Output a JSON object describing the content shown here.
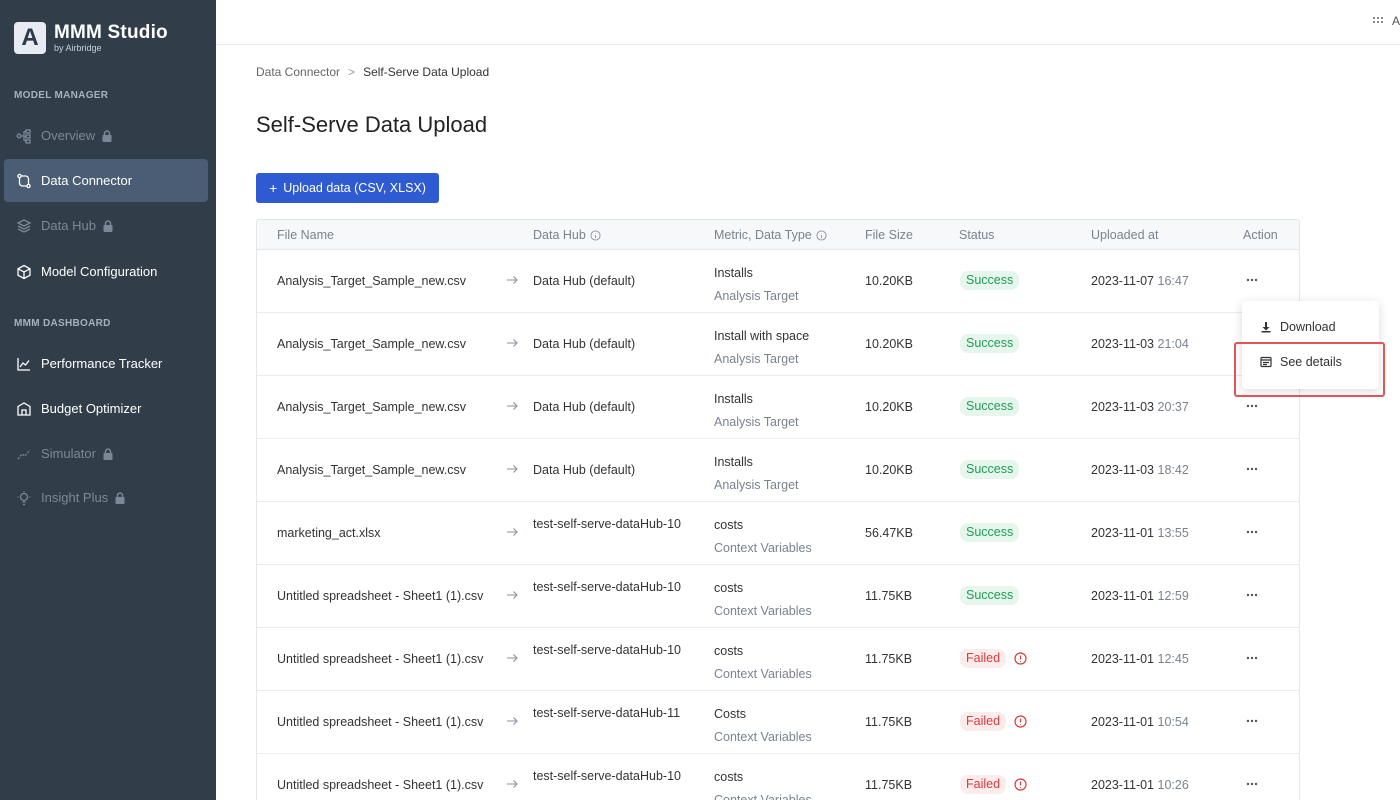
{
  "sidebar": {
    "brand_logo": "A",
    "brand_title": "MMM Studio",
    "brand_sub": "by Airbridge",
    "sections": [
      {
        "label": "MODEL MANAGER"
      },
      {
        "label": "MMM DASHBOARD"
      }
    ],
    "items": [
      {
        "label": "Overview",
        "icon": "overview-icon",
        "locked": true
      },
      {
        "label": "Data Connector",
        "icon": "data-connector-icon",
        "active": true
      },
      {
        "label": "Data Hub",
        "icon": "data-hub-icon",
        "locked": true
      },
      {
        "label": "Model Configuration",
        "icon": "cube-icon"
      },
      {
        "label": "Performance Tracker",
        "icon": "chart-line-icon"
      },
      {
        "label": "Budget Optimizer",
        "icon": "bank-icon"
      },
      {
        "label": "Simulator",
        "icon": "simulator-icon",
        "locked": true
      },
      {
        "label": "Insight Plus",
        "icon": "bulb-icon",
        "locked": true
      }
    ]
  },
  "topbar": {
    "apps_label": "A"
  },
  "breadcrumb": {
    "parent": "Data Connector",
    "separator": ">",
    "current": "Self-Serve Data Upload"
  },
  "page": {
    "title": "Self-Serve Data Upload"
  },
  "upload_button": {
    "plus": "+",
    "label": "Upload data (CSV, XLSX)"
  },
  "table": {
    "headers": {
      "file_name": "File Name",
      "data_hub": "Data Hub",
      "metric": "Metric, Data Type",
      "file_size": "File Size",
      "status": "Status",
      "uploaded_at": "Uploaded at",
      "action": "Action"
    },
    "rows": [
      {
        "file": "Analysis_Target_Sample_new.csv",
        "hub": "Data Hub (default)",
        "metric": "Installs",
        "type": "Analysis Target",
        "size": "10.20KB",
        "status": "Success",
        "date": "2023-11-07",
        "time": "16:47"
      },
      {
        "file": "Analysis_Target_Sample_new.csv",
        "hub": "Data Hub (default)",
        "metric": "Install with space",
        "type": "Analysis Target",
        "size": "10.20KB",
        "status": "Success",
        "date": "2023-11-03",
        "time": "21:04"
      },
      {
        "file": "Analysis_Target_Sample_new.csv",
        "hub": "Data Hub (default)",
        "metric": "Installs",
        "type": "Analysis Target",
        "size": "10.20KB",
        "status": "Success",
        "date": "2023-11-03",
        "time": "20:37"
      },
      {
        "file": "Analysis_Target_Sample_new.csv",
        "hub": "Data Hub (default)",
        "metric": "Installs",
        "type": "Analysis Target",
        "size": "10.20KB",
        "status": "Success",
        "date": "2023-11-03",
        "time": "18:42"
      },
      {
        "file": "marketing_act.xlsx",
        "hub": "test-self-serve-dataHub-10",
        "metric": "costs",
        "type": "Context Variables",
        "size": "56.47KB",
        "status": "Success",
        "date": "2023-11-01",
        "time": "13:55"
      },
      {
        "file": "Untitled spreadsheet - Sheet1 (1).csv",
        "hub": "test-self-serve-dataHub-10",
        "metric": "costs",
        "type": "Context Variables",
        "size": "11.75KB",
        "status": "Success",
        "date": "2023-11-01",
        "time": "12:59"
      },
      {
        "file": "Untitled spreadsheet - Sheet1 (1).csv",
        "hub": "test-self-serve-dataHub-10",
        "metric": "costs",
        "type": "Context Variables",
        "size": "11.75KB",
        "status": "Failed",
        "date": "2023-11-01",
        "time": "12:45"
      },
      {
        "file": "Untitled spreadsheet - Sheet1 (1).csv",
        "hub": "test-self-serve-dataHub-11",
        "metric": "Costs",
        "type": "Context Variables",
        "size": "11.75KB",
        "status": "Failed",
        "date": "2023-11-01",
        "time": "10:54"
      },
      {
        "file": "Untitled spreadsheet - Sheet1 (1).csv",
        "hub": "test-self-serve-dataHub-10",
        "metric": "costs",
        "type": "Context Variables",
        "size": "11.75KB",
        "status": "Failed",
        "date": "2023-11-01",
        "time": "10:26"
      }
    ]
  },
  "action_menu": {
    "download_label": "Download",
    "details_label": "See details"
  },
  "colors": {
    "sidebar_bg": "#323d4a",
    "sidebar_active": "#4b5d74",
    "primary": "#2f5bd2",
    "success": "#1f9d55",
    "failed": "#d93a3a",
    "highlight": "#e25555"
  }
}
